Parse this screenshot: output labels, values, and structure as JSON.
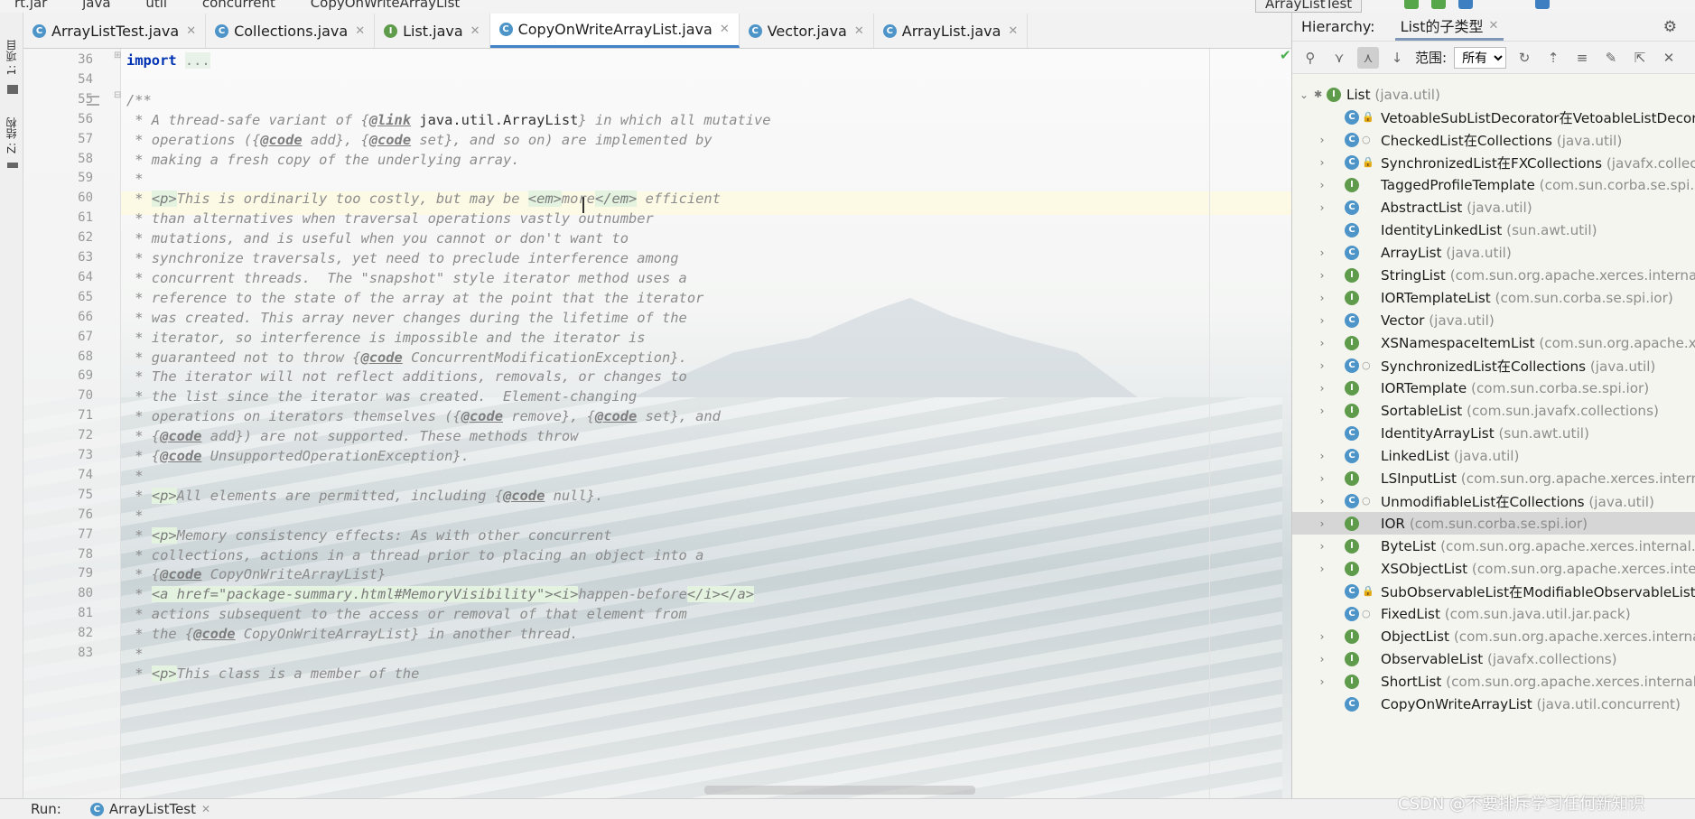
{
  "breadcrumb": [
    "rt.jar",
    "java",
    "util",
    "concurrent",
    "CopyOnWriteArrayList"
  ],
  "run_config": "ArrayListTest",
  "left_strip": {
    "project": "1: 项目",
    "structure": "Z: 结构"
  },
  "tabs": [
    {
      "label": "ArrayListTest.java",
      "icon": "C"
    },
    {
      "label": "Collections.java",
      "icon": "C"
    },
    {
      "label": "List.java",
      "icon": "I"
    },
    {
      "label": "CopyOnWriteArrayList.java",
      "icon": "C"
    },
    {
      "label": "Vector.java",
      "icon": "C"
    },
    {
      "label": "ArrayList.java",
      "icon": "C"
    }
  ],
  "active_tab": 3,
  "code": [
    {
      "n": "36",
      "t": "import ..."
    },
    {
      "n": "54",
      "t": ""
    },
    {
      "n": "55",
      "t": "/**"
    },
    {
      "n": "56",
      "t": " * A thread-safe variant of {@link java.util.ArrayList} in which all mutative"
    },
    {
      "n": "57",
      "t": " * operations ({@code add}, {@code set}, and so on) are implemented by"
    },
    {
      "n": "58",
      "t": " * making a fresh copy of the underlying array."
    },
    {
      "n": "59",
      "t": " *"
    },
    {
      "n": "60",
      "t": " * <p>This is ordinarily too costly, but may be <em>more</em> efficient"
    },
    {
      "n": "61",
      "t": " * than alternatives when traversal operations vastly outnumber"
    },
    {
      "n": "62",
      "t": " * mutations, and is useful when you cannot or don't want to"
    },
    {
      "n": "63",
      "t": " * synchronize traversals, yet need to preclude interference among"
    },
    {
      "n": "64",
      "t": " * concurrent threads.  The \"snapshot\" style iterator method uses a"
    },
    {
      "n": "65",
      "t": " * reference to the state of the array at the point that the iterator"
    },
    {
      "n": "66",
      "t": " * was created. This array never changes during the lifetime of the"
    },
    {
      "n": "67",
      "t": " * iterator, so interference is impossible and the iterator is"
    },
    {
      "n": "68",
      "t": " * guaranteed not to throw {@code ConcurrentModificationException}."
    },
    {
      "n": "69",
      "t": " * The iterator will not reflect additions, removals, or changes to"
    },
    {
      "n": "70",
      "t": " * the list since the iterator was created.  Element-changing"
    },
    {
      "n": "71",
      "t": " * operations on iterators themselves ({@code remove}, {@code set}, and"
    },
    {
      "n": "72",
      "t": " * {@code add}) are not supported. These methods throw"
    },
    {
      "n": "73",
      "t": " * {@code UnsupportedOperationException}."
    },
    {
      "n": "74",
      "t": " *"
    },
    {
      "n": "75",
      "t": " * <p>All elements are permitted, including {@code null}."
    },
    {
      "n": "76",
      "t": " *"
    },
    {
      "n": "77",
      "t": " * <p>Memory consistency effects: As with other concurrent"
    },
    {
      "n": "78",
      "t": " * collections, actions in a thread prior to placing an object into a"
    },
    {
      "n": "79",
      "t": " * {@code CopyOnWriteArrayList}"
    },
    {
      "n": "80",
      "t": " * <a href=\"package-summary.html#MemoryVisibility\"><i>happen-before</i></a>"
    },
    {
      "n": "81",
      "t": " * actions subsequent to the access or removal of that element from"
    },
    {
      "n": "82",
      "t": " * the {@code CopyOnWriteArrayList} in another thread."
    },
    {
      "n": "83",
      "t": " *"
    },
    {
      "n": "",
      "t": " * <p>This class is a member of the"
    }
  ],
  "hierarchy": {
    "title": "Hierarchy:",
    "tab": "List的子类型",
    "scope_label": "范围:",
    "scope_value": "所有",
    "items": [
      {
        "name": "List",
        "pkg": "(java.util)",
        "kind": "i",
        "level": 0,
        "exp": "open"
      },
      {
        "name": "VetoableSubListDecorator在VetoableListDecorator",
        "pkg": "",
        "kind": "c",
        "level": 1,
        "exp": "",
        "mod": "lock"
      },
      {
        "name": "CheckedList在Collections",
        "pkg": "(java.util)",
        "kind": "c",
        "level": 1,
        "exp": "closed",
        "mod": "dot"
      },
      {
        "name": "SynchronizedList在FXCollections",
        "pkg": "(javafx.collections)",
        "kind": "c",
        "level": 1,
        "exp": "closed",
        "mod": "lock"
      },
      {
        "name": "TaggedProfileTemplate",
        "pkg": "(com.sun.corba.se.spi.ior)",
        "kind": "i",
        "level": 1,
        "exp": "closed"
      },
      {
        "name": "AbstractList",
        "pkg": "(java.util)",
        "kind": "c",
        "level": 1,
        "exp": "closed"
      },
      {
        "name": "IdentityLinkedList",
        "pkg": "(sun.awt.util)",
        "kind": "c",
        "level": 1,
        "exp": ""
      },
      {
        "name": "ArrayList",
        "pkg": "(java.util)",
        "kind": "c",
        "level": 1,
        "exp": "closed"
      },
      {
        "name": "StringList",
        "pkg": "(com.sun.org.apache.xerces.internal.xs)",
        "kind": "i",
        "level": 1,
        "exp": "closed"
      },
      {
        "name": "IORTemplateList",
        "pkg": "(com.sun.corba.se.spi.ior)",
        "kind": "i",
        "level": 1,
        "exp": "closed"
      },
      {
        "name": "Vector",
        "pkg": "(java.util)",
        "kind": "c",
        "level": 1,
        "exp": "closed"
      },
      {
        "name": "XSNamespaceItemList",
        "pkg": "(com.sun.org.apache.xerces)",
        "kind": "i",
        "level": 1,
        "exp": "closed"
      },
      {
        "name": "SynchronizedList在Collections",
        "pkg": "(java.util)",
        "kind": "c",
        "level": 1,
        "exp": "closed",
        "mod": "dot"
      },
      {
        "name": "IORTemplate",
        "pkg": "(com.sun.corba.se.spi.ior)",
        "kind": "i",
        "level": 1,
        "exp": "closed"
      },
      {
        "name": "SortableList",
        "pkg": "(com.sun.javafx.collections)",
        "kind": "i",
        "level": 1,
        "exp": "closed"
      },
      {
        "name": "IdentityArrayList",
        "pkg": "(sun.awt.util)",
        "kind": "c",
        "level": 1,
        "exp": ""
      },
      {
        "name": "LinkedList",
        "pkg": "(java.util)",
        "kind": "c",
        "level": 1,
        "exp": "closed"
      },
      {
        "name": "LSInputList",
        "pkg": "(com.sun.org.apache.xerces.internal)",
        "kind": "i",
        "level": 1,
        "exp": "closed"
      },
      {
        "name": "UnmodifiableList在Collections",
        "pkg": "(java.util)",
        "kind": "c",
        "level": 1,
        "exp": "closed",
        "mod": "dot"
      },
      {
        "name": "IOR",
        "pkg": "(com.sun.corba.se.spi.ior)",
        "kind": "i",
        "level": 1,
        "exp": "closed",
        "selected": true
      },
      {
        "name": "ByteList",
        "pkg": "(com.sun.org.apache.xerces.internal.xs)",
        "kind": "i",
        "level": 1,
        "exp": "closed"
      },
      {
        "name": "XSObjectList",
        "pkg": "(com.sun.org.apache.xerces.internal)",
        "kind": "i",
        "level": 1,
        "exp": "closed"
      },
      {
        "name": "SubObservableList在ModifiableObservableListBase",
        "pkg": "",
        "kind": "c",
        "level": 1,
        "exp": "",
        "mod": "lock"
      },
      {
        "name": "FixedList",
        "pkg": "(com.sun.java.util.jar.pack)",
        "kind": "c",
        "level": 1,
        "exp": "",
        "mod": "dot"
      },
      {
        "name": "ObjectList",
        "pkg": "(com.sun.org.apache.xerces.internal.xs)",
        "kind": "i",
        "level": 1,
        "exp": "closed"
      },
      {
        "name": "ObservableList",
        "pkg": "(javafx.collections)",
        "kind": "i",
        "level": 1,
        "exp": "closed"
      },
      {
        "name": "ShortList",
        "pkg": "(com.sun.org.apache.xerces.internal.xs)",
        "kind": "i",
        "level": 1,
        "exp": "closed"
      },
      {
        "name": "CopyOnWriteArrayList",
        "pkg": "(java.util.concurrent)",
        "kind": "c",
        "level": 1,
        "exp": ""
      }
    ]
  },
  "run_bar": {
    "label": "Run:",
    "tab": "ArrayListTest"
  },
  "watermark": "CSDN @不要排斥学习任何新知识",
  "colors": {
    "accent": "#4083c9",
    "class_icon": "#4d94c8",
    "interface_icon": "#5e9b4a",
    "comment": "#8c8c8c",
    "keyword": "#0033b3",
    "highlight": "#fcfae3"
  }
}
